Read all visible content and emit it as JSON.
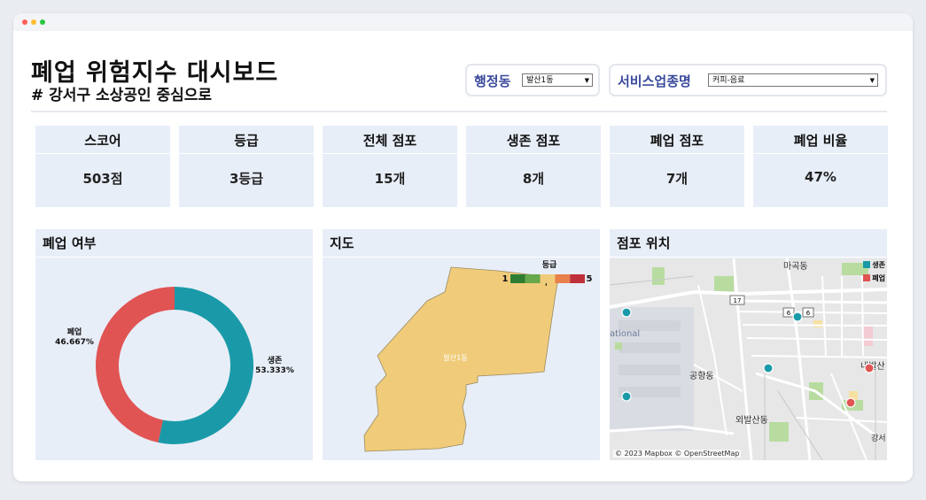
{
  "header": {
    "title": "폐업 위험지수 대시보드",
    "subtitle": "# 강서구 소상공인 중심으로"
  },
  "filters": {
    "district_label": "행정동",
    "district_value": "발산1동",
    "service_label": "서비스업종명",
    "service_value": "커피-음료"
  },
  "kpis": [
    {
      "label": "스코어",
      "value": "503점"
    },
    {
      "label": "등급",
      "value": "3등급"
    },
    {
      "label": "전체 점포",
      "value": "15개"
    },
    {
      "label": "생존 점포",
      "value": "8개"
    },
    {
      "label": "폐업 점포",
      "value": "7개"
    },
    {
      "label": "폐업 비율",
      "value": "47%"
    }
  ],
  "panels": {
    "closure_title": "폐업 여부",
    "map_title": "지도",
    "store_title": "점포 위치"
  },
  "chart_data": {
    "type": "pie",
    "categories": [
      "생존",
      "폐업"
    ],
    "values": [
      53.333,
      46.667
    ],
    "labels": [
      "생존 53.333%",
      "폐업 46.667%"
    ],
    "colors": [
      "#1a9aa8",
      "#e05454"
    ],
    "donut": true
  },
  "choropleth": {
    "legend_title": "등급",
    "legend_min": "1",
    "legend_max": "5",
    "grade_colors": [
      "#2e7d32",
      "#66a84a",
      "#f0cc7a",
      "#e8804a",
      "#c0303a"
    ],
    "region_label": "발산1동",
    "region_color": "#f0cc7a"
  },
  "store_map": {
    "legend": [
      {
        "label": "생존",
        "color": "#1a9aa8"
      },
      {
        "label": "폐업",
        "color": "#e05454"
      }
    ],
    "place_labels": [
      "마곡동",
      "공항동",
      "외발산동",
      "내발산",
      "ational",
      "강서"
    ],
    "road_markers": [
      "17",
      "6",
      "6"
    ],
    "credit": "© 2023 Mapbox © OpenStreetMap"
  }
}
